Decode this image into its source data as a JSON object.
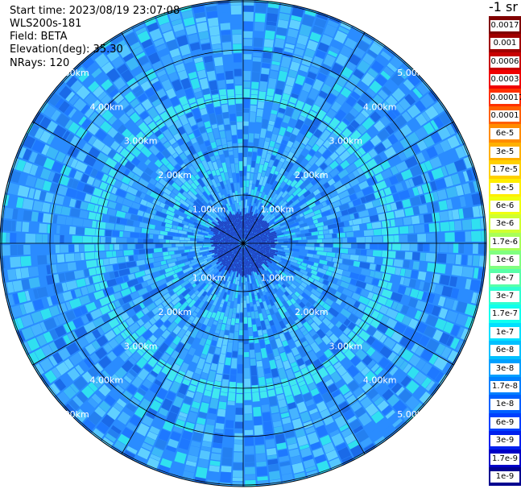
{
  "header": {
    "start_time": "Start time: 2023/08/19 23:07:08",
    "instrument": "WLS200s-181",
    "field": "Field: BETA",
    "elevation": "Elevation(deg): 35.30",
    "nrays": "NRays: 120"
  },
  "colorbar": {
    "unit_label": "-1 sr",
    "ticks": [
      "0.0017",
      "0.001",
      "0.0006",
      "0.0003",
      "0.00017",
      "0.0001",
      "6e-5",
      "3e-5",
      "1.7e-5",
      "1e-5",
      "6e-6",
      "3e-6",
      "1.7e-6",
      "1e-6",
      "6e-7",
      "3e-7",
      "1.7e-7",
      "1e-7",
      "6e-8",
      "3e-8",
      "1.7e-8",
      "1e-8",
      "6e-9",
      "3e-9",
      "1.7e-9",
      "1e-9"
    ],
    "colors": [
      "#800000",
      "#a00000",
      "#c80000",
      "#f00000",
      "#ff3000",
      "#ff6000",
      "#ff8c00",
      "#ffb000",
      "#ffd000",
      "#ffee00",
      "#f0ff10",
      "#d0ff30",
      "#a8ff58",
      "#80ff80",
      "#58ffa8",
      "#30ffd0",
      "#10ffee",
      "#00e0ff",
      "#00c0ff",
      "#00a0ff",
      "#0080ff",
      "#0060ff",
      "#0040ff",
      "#0020ee",
      "#0000c8",
      "#000090"
    ]
  },
  "range_rings": {
    "labels": [
      "1.00km",
      "2.00km",
      "3.00km",
      "4.00km",
      "5.00km"
    ]
  },
  "plot_colors": {
    "background": "#2a8cff",
    "ring_bright": "#40e8f0",
    "center": "#2040c0"
  }
}
